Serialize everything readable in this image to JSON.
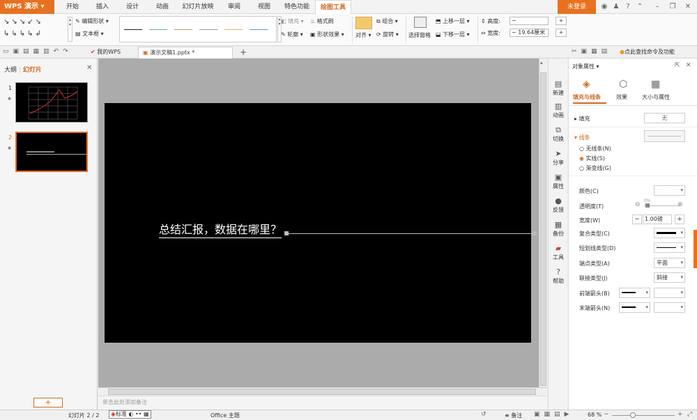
{
  "app": {
    "logo": "WPS 演示",
    "login": "未登录"
  },
  "menu": [
    "开始",
    "插入",
    "设计",
    "动画",
    "幻灯片放映",
    "审阅",
    "视图",
    "特色功能",
    "绘图工具"
  ],
  "ribbon": {
    "edit_shape": "编辑形状",
    "text_box": "文本框",
    "fill": "填充",
    "outline": "轮廓",
    "format_painter": "格式刷",
    "shape_effect": "形状效果",
    "align": "对齐",
    "group": "组合",
    "rotate": "旋转",
    "selection_pane": "选择窗格",
    "bring_forward": "上移一层",
    "send_backward": "下移一层",
    "height_label": "高度:",
    "width_label": "宽度:",
    "width_value": "19.64厘米"
  },
  "quickbar": {
    "tab_mywps": "我的WPS",
    "tab_doc": "演示文稿1.pptx *",
    "search_hint": "点此查找命令及功能"
  },
  "leftpanel": {
    "tab_outline": "大纲",
    "tab_slides": "幻灯片",
    "slide_numbers": [
      "1",
      "2"
    ]
  },
  "slide": {
    "text": "总结汇报，数据在哪里？"
  },
  "notes": "单击此处添加备注",
  "sidestrip": [
    "新建",
    "动画",
    "切换",
    "分享",
    "属性",
    "反馈",
    "备份",
    "工具",
    "帮助"
  ],
  "props": {
    "title": "对象属性",
    "tabs": [
      "填充与线条",
      "效果",
      "大小与属性"
    ],
    "fill_label": "填充",
    "fill_value": "无",
    "line_label": "线条",
    "radio": [
      "无线条(N)",
      "实线(S)",
      "渐变线(G)"
    ],
    "color": "颜色(C)",
    "transparency": "透明度(T)",
    "transparency_value": "0%",
    "width": "宽度(W)",
    "width_value": "1.00磅",
    "compound": "复合类型(C)",
    "dash": "短划线类型(D)",
    "cap": "端点类型(A)",
    "cap_value": "平面",
    "join": "联接类型(J)",
    "join_value": "斜接",
    "begin_arrow": "前端箭头(B)",
    "end_arrow": "末端箭头(N)"
  },
  "status": {
    "slide_info": "幻灯片 2 / 2",
    "std_label": "标准",
    "theme": "Office 主题",
    "notes_btn": "备注",
    "zoom": "68 %"
  },
  "colors": {
    "accent": "#e8711e",
    "slide_bg": "#000000",
    "canvas_bg": "#ababab"
  }
}
